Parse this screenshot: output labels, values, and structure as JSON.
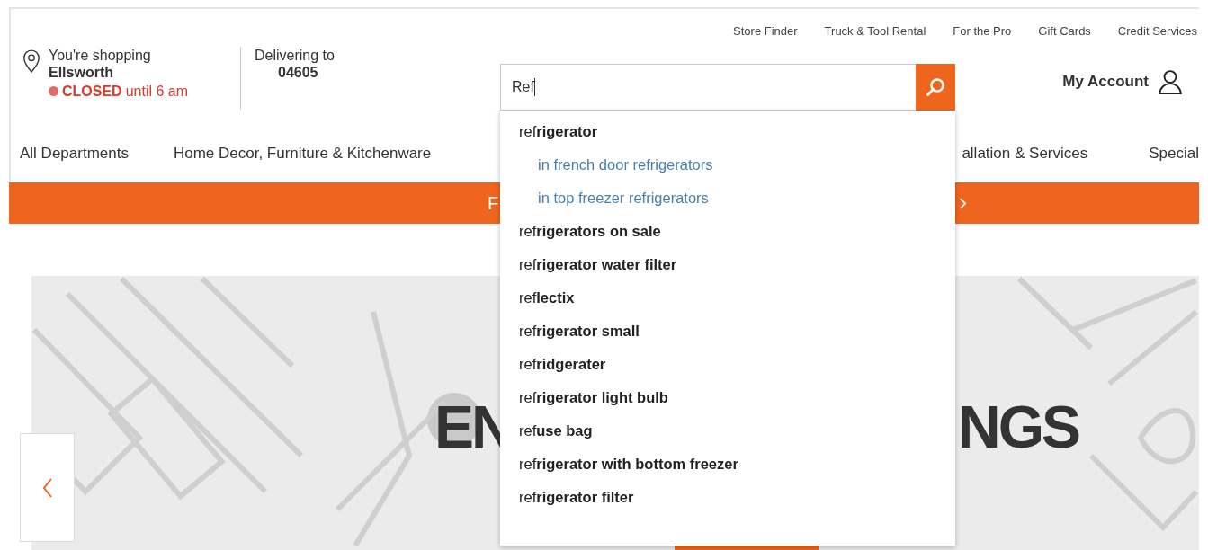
{
  "utility_links": [
    "Store Finder",
    "Truck & Tool Rental",
    "For the Pro",
    "Gift Cards",
    "Credit Services"
  ],
  "store": {
    "label": "You're shopping",
    "name": "Ellsworth",
    "status": "CLOSED",
    "status_detail": "until 6 am",
    "open": false
  },
  "delivery": {
    "label": "Delivering to",
    "zip": "04605"
  },
  "search": {
    "value": "Ref"
  },
  "account": {
    "label": "My Account"
  },
  "nav": [
    "All Departments",
    "Home Decor, Furniture & Kitchenware",
    "allation & Services",
    "Special"
  ],
  "promo_banner": {
    "text": "F"
  },
  "hero": {
    "headline_left": "EN",
    "headline_right": "NGS"
  },
  "suggestions": [
    {
      "kind": "query",
      "text": "ref**rigerator**"
    },
    {
      "kind": "category",
      "text": "in french door refrigerators"
    },
    {
      "kind": "category",
      "text": "in top freezer refrigerators"
    },
    {
      "kind": "query",
      "text": "ref**rigerators on sale**"
    },
    {
      "kind": "query",
      "text": "ref**rigerator water filter**"
    },
    {
      "kind": "query",
      "text": "ref**lectix**"
    },
    {
      "kind": "query",
      "text": "ref**rigerator small**"
    },
    {
      "kind": "query",
      "text": "ref**ridgerater**"
    },
    {
      "kind": "query",
      "text": "ref**rigerator light bulb**"
    },
    {
      "kind": "query",
      "text": "ref**use bag**"
    },
    {
      "kind": "query",
      "text": "ref**rigerator with bottom freezer**"
    },
    {
      "kind": "query",
      "text": "ref**rigerator filter**"
    }
  ]
}
